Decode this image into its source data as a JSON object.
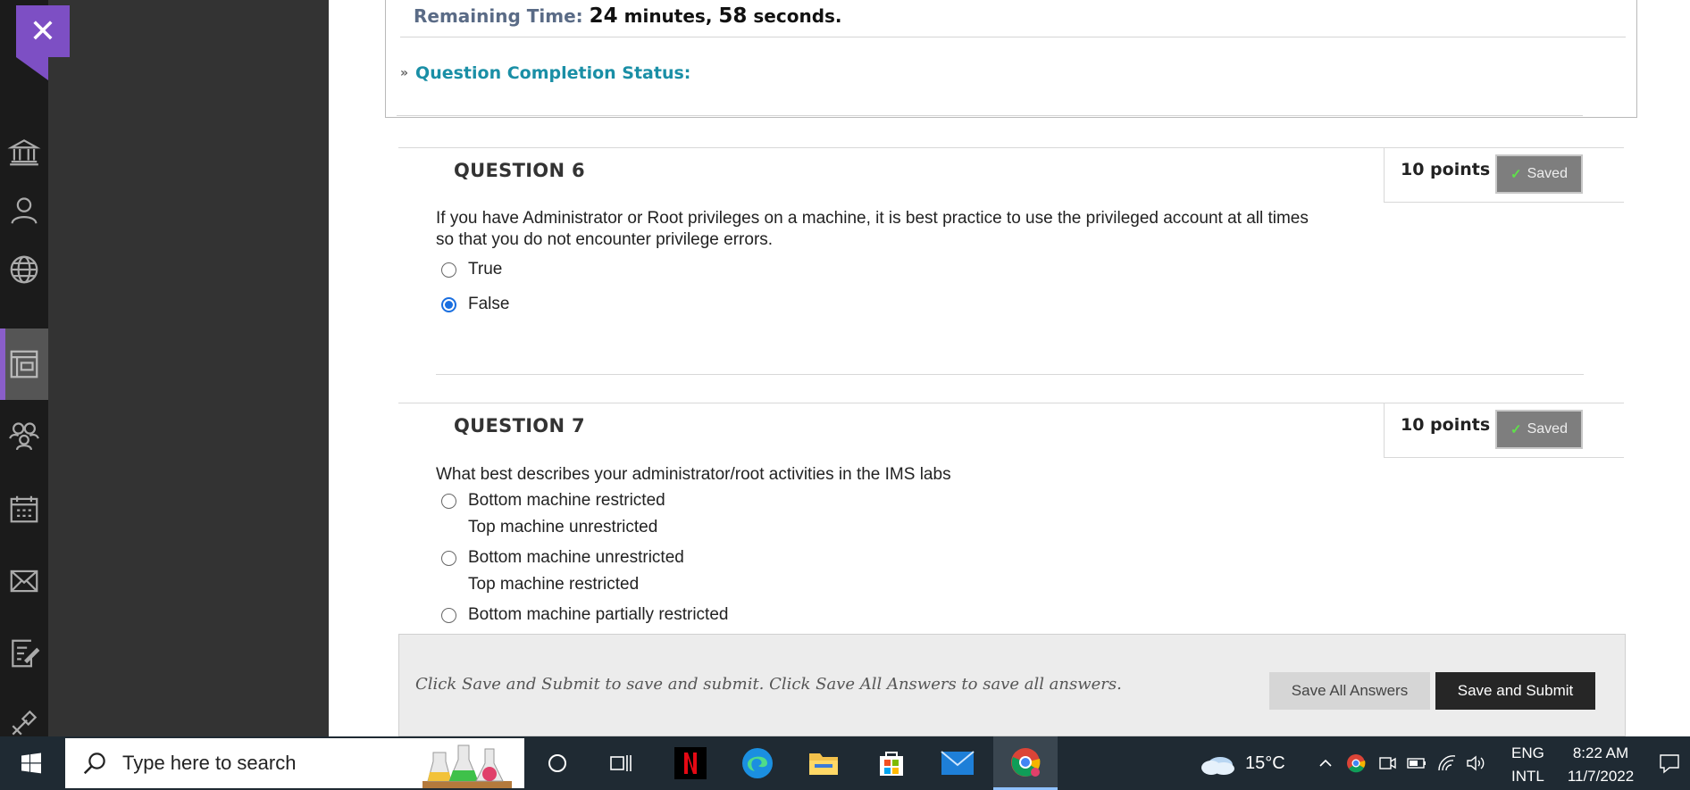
{
  "timer": {
    "label": "Remaining Time:",
    "minutes": "24",
    "minutes_unit": "minutes,",
    "seconds": "58",
    "seconds_unit": "seconds."
  },
  "completion_label": "Question Completion Status:",
  "questions": [
    {
      "title": "QUESTION 6",
      "points": "10 points",
      "saved": "Saved",
      "text": "If you have Administrator or Root privileges on a machine, it is best practice to use the privileged account at all times so that you do not encounter privilege errors.",
      "options": [
        {
          "label": "True",
          "selected": false
        },
        {
          "label": "False",
          "selected": true
        }
      ]
    },
    {
      "title": "QUESTION 7",
      "points": "10 points",
      "saved": "Saved",
      "text": "What best describes your administrator/root activities in the IMS labs",
      "options": [
        {
          "line1": "Bottom machine restricted",
          "line2": "Top machine unrestricted",
          "selected": false
        },
        {
          "line1": "Bottom machine unrestricted",
          "line2": "Top machine restricted",
          "selected": false
        },
        {
          "line1": "Bottom machine partially restricted",
          "selected": false
        }
      ]
    }
  ],
  "footer": {
    "instructions": "Click Save and Submit to save and submit. Click Save All Answers to save all answers.",
    "save_all": "Save All Answers",
    "save_submit": "Save and Submit"
  },
  "taskbar": {
    "search_placeholder": "Type here to search",
    "weather": "15°C",
    "lang_top": "ENG",
    "lang_bottom": "INTL",
    "time": "8:22 AM",
    "date": "11/7/2022"
  },
  "colors": {
    "accent_purple": "#7d4fc4",
    "link_teal": "#1a8fa6",
    "radio_blue": "#1a6fe0",
    "saved_check": "#5fe04a"
  },
  "icons": {
    "left_nav": [
      "institution-icon",
      "profile-icon",
      "globe-icon",
      "courses-icon",
      "groups-icon",
      "calendar-icon",
      "messages-icon",
      "grades-icon",
      "tools-icon"
    ],
    "taskbar": [
      "windows-start-icon",
      "search-icon",
      "cortana-icon",
      "task-view-icon",
      "netflix-icon",
      "edge-icon",
      "file-explorer-icon",
      "store-icon",
      "mail-icon",
      "chrome-icon"
    ]
  }
}
